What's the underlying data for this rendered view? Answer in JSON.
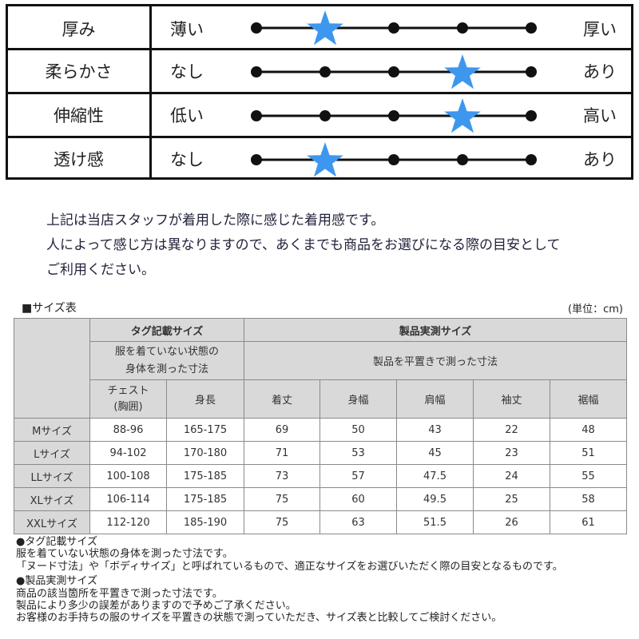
{
  "rating": {
    "scale_steps": 5,
    "star_color": "#3d97ee",
    "rows": [
      {
        "label": "厚み",
        "left": "薄い",
        "right": "厚い",
        "value": 2
      },
      {
        "label": "柔らかさ",
        "left": "なし",
        "right": "あり",
        "value": 4
      },
      {
        "label": "伸縮性",
        "left": "低い",
        "right": "高い",
        "value": 4
      },
      {
        "label": "透け感",
        "left": "なし",
        "right": "あり",
        "value": 2
      }
    ]
  },
  "note": {
    "lines": [
      "上記は当店スタッフが着用した際に感じた着用感です。",
      "人によって感じ方は異なりますので、あくまでも商品をお選びになる際の目安として",
      "ご利用ください。"
    ]
  },
  "size_table": {
    "title": "■サイズ表",
    "unit": "(単位：cm)",
    "group_tag": "タグ記載サイズ",
    "group_tag_desc_1": "服を着ていない状態の",
    "group_tag_desc_2": "身体を測った寸法",
    "group_product": "製品実測サイズ",
    "group_product_desc": "製品を平置きで測った寸法",
    "columns": [
      "チェスト",
      "(胸囲)",
      "身長",
      "着丈",
      "身幅",
      "肩幅",
      "袖丈",
      "裾幅"
    ],
    "rows": [
      {
        "size": "Mサイズ",
        "chest": "88-96",
        "height": "165-175",
        "length": "69",
        "body_width": "50",
        "shoulder": "43",
        "sleeve": "22",
        "hem": "48"
      },
      {
        "size": "Lサイズ",
        "chest": "94-102",
        "height": "170-180",
        "length": "71",
        "body_width": "53",
        "shoulder": "45",
        "sleeve": "23",
        "hem": "51"
      },
      {
        "size": "LLサイズ",
        "chest": "100-108",
        "height": "175-185",
        "length": "73",
        "body_width": "57",
        "shoulder": "47.5",
        "sleeve": "24",
        "hem": "55"
      },
      {
        "size": "XLサイズ",
        "chest": "106-114",
        "height": "175-185",
        "length": "75",
        "body_width": "60",
        "shoulder": "49.5",
        "sleeve": "25",
        "hem": "58"
      },
      {
        "size": "XXLサイズ",
        "chest": "112-120",
        "height": "185-190",
        "length": "75",
        "body_width": "63",
        "shoulder": "51.5",
        "sleeve": "26",
        "hem": "61"
      }
    ]
  },
  "footnotes": {
    "lines": [
      "●タグ記載サイズ",
      "服を着ていない状態の身体を測った寸法です。",
      "「ヌード寸法」や「ボディサイズ」と呼ばれているもので、適正なサイズをお選びいただく際の目安となるものです。",
      "●製品実測サイズ",
      "商品の該当箇所を平置きで測った寸法です。",
      "製品により多少の誤差がありますので予めご了承ください。",
      "お客様のお手持ちの服のサイズを平置きの状態で測っていただき、サイズ表と比較してご検討ください。"
    ]
  }
}
